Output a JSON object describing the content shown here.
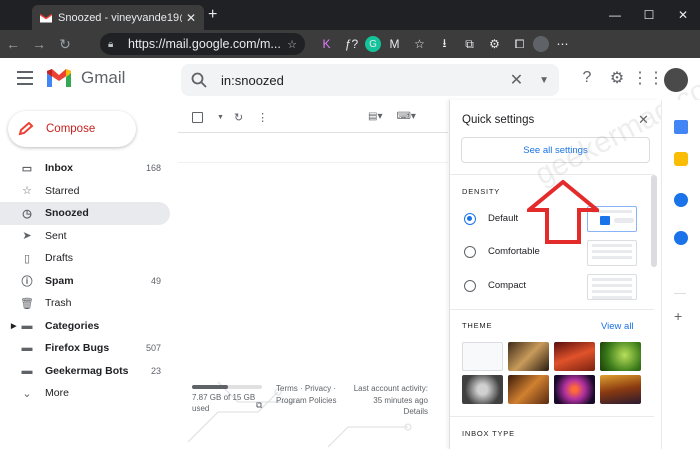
{
  "browser": {
    "tab_title": "Snoozed - vineyvande19@gmail.",
    "tab_close": "✕",
    "new_tab": "+",
    "url": "https://mail.google.com/m...",
    "window_controls": [
      "—",
      "☐",
      "✕"
    ],
    "extensions": [
      "K",
      "ƒ?",
      "G",
      "M"
    ]
  },
  "gmail": {
    "logo_text": "Gmail",
    "search": {
      "value": "in:snoozed"
    },
    "compose_label": "Compose",
    "nav": [
      {
        "label": "Inbox",
        "count": "168",
        "icon": "inbox-icon",
        "bold": true
      },
      {
        "label": "Starred",
        "count": "",
        "icon": "star-icon",
        "bold": false
      },
      {
        "label": "Snoozed",
        "count": "",
        "icon": "clock-icon",
        "bold": true,
        "active": true
      },
      {
        "label": "Sent",
        "count": "",
        "icon": "send-icon",
        "bold": false
      },
      {
        "label": "Drafts",
        "count": "",
        "icon": "drafts-icon",
        "bold": false
      },
      {
        "label": "Spam",
        "count": "49",
        "icon": "spam-icon",
        "bold": true
      },
      {
        "label": "Trash",
        "count": "",
        "icon": "trash-icon",
        "bold": false
      },
      {
        "label": "Categories",
        "count": "",
        "icon": "label-icon",
        "bold": true
      },
      {
        "label": "Firefox Bugs",
        "count": "507",
        "icon": "label-icon",
        "bold": true
      },
      {
        "label": "Geekermag Bots",
        "count": "23",
        "icon": "label-icon",
        "bold": true
      },
      {
        "label": "More",
        "count": "",
        "icon": "chevron-down-icon",
        "bold": false
      }
    ],
    "storage": {
      "text": "7.87 GB of 15 GB used",
      "fraction": 0.52
    },
    "footer_links": "Terms · Privacy · Program Policies",
    "last_activity": "Last account activity: 35 minutes ago",
    "details": "Details"
  },
  "quick_settings": {
    "title": "Quick settings",
    "see_all": "See all settings",
    "density_heading": "DENSITY",
    "density_options": [
      "Default",
      "Comfortable",
      "Compact"
    ],
    "density_selected": "Default",
    "theme_heading": "THEME",
    "view_all": "View all",
    "inbox_type_heading": "INBOX TYPE"
  },
  "colors": {
    "accent": "#1a73e8",
    "compose_red": "#c5221f",
    "arrow_red": "#e32b2b"
  }
}
